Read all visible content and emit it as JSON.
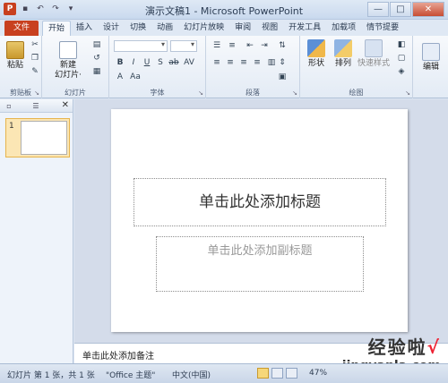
{
  "window": {
    "title": "演示文稿1 - Microsoft PowerPoint",
    "app_icon": "P"
  },
  "qat": [
    {
      "name": "save-icon",
      "glyph": "▪"
    },
    {
      "name": "undo-icon",
      "glyph": "↶"
    },
    {
      "name": "redo-icon",
      "glyph": "↷"
    },
    {
      "name": "customize-qat-icon",
      "glyph": "▾"
    }
  ],
  "window_controls": {
    "minimize": "—",
    "maximize": "□",
    "close": "✕"
  },
  "tabs": [
    "文件",
    "开始",
    "插入",
    "设计",
    "切换",
    "动画",
    "幻灯片放映",
    "审阅",
    "视图",
    "开发工具",
    "加载项",
    "情节提要"
  ],
  "active_tab_index": 1,
  "ribbon": {
    "groups": {
      "clipboard": {
        "label": "剪贴板",
        "paste": "粘贴"
      },
      "slides": {
        "label": "幻灯片",
        "new_slide": "新建\n幻灯片·"
      },
      "font": {
        "label": "字体"
      },
      "paragraph": {
        "label": "段落"
      },
      "drawing": {
        "label": "绘图",
        "shape": "形状",
        "arrange": "排列",
        "quick_styles": "快速样式"
      },
      "editing": {
        "label": "编辑"
      }
    }
  },
  "slides_pane": {
    "slide_number": "1"
  },
  "slide": {
    "title_placeholder": "单击此处添加标题",
    "subtitle_placeholder": "单击此处添加副标题"
  },
  "notes": {
    "placeholder": "单击此处添加备注"
  },
  "status_bar": {
    "slide_info": "幻灯片 第 1 张，共 1 张",
    "theme": "\"Office 主题\"",
    "language": "中文(中国)",
    "zoom": "47%"
  },
  "watermark": {
    "text": "经验啦",
    "check": "√",
    "url": "jingyanla.com"
  },
  "colors": {
    "file_tab": "#c8401f",
    "accent_active_view": "#f6d77a"
  }
}
